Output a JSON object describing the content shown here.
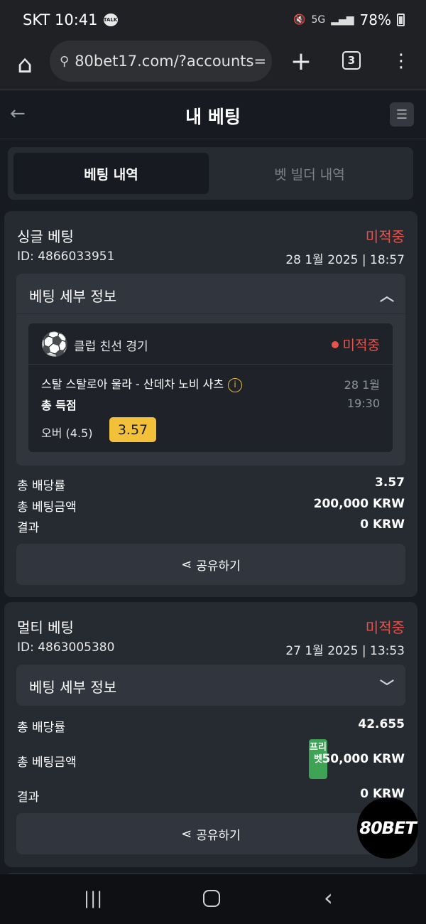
{
  "status_bar": {
    "carrier_time": "SKT 10:41",
    "talk_badge": "TALK",
    "network": "5G",
    "battery": "78%"
  },
  "browser": {
    "url": "80bet17.com/?accounts=",
    "tab_count": "3"
  },
  "header": {
    "title": "내 베팅"
  },
  "tabs": [
    {
      "label": "베팅 내역",
      "active": true
    },
    {
      "label": "벳 빌더 내역",
      "active": false
    }
  ],
  "bets": [
    {
      "type": "싱글 베팅",
      "status": "미적중",
      "id": "ID: 4866033951",
      "datetime": "28 1월 2025 | 18:57",
      "details_title": "베팅 세부 정보",
      "expanded": true,
      "selection": {
        "league": "클럽 친선 경기",
        "status": "미적중",
        "match": "스탈 스탈로아 울라 - 산데차 노비 사츠",
        "date": "28 1월",
        "time": "19:30",
        "market": "총 득점",
        "pick": "오버 (4.5)",
        "odds": "3.57"
      },
      "total_odds_label": "총 배당률",
      "total_odds": "3.57",
      "stake_label": "총 베팅금액",
      "stake": "200,000 KRW",
      "result_label": "결과",
      "result": "0 KRW",
      "share_label": "공유하기"
    },
    {
      "type": "멀티 베팅",
      "status": "미적중",
      "id": "ID: 4863005380",
      "datetime": "27 1월 2025 | 13:53",
      "details_title": "베팅 세부 정보",
      "expanded": false,
      "total_odds_label": "총 배당률",
      "total_odds": "42.655",
      "stake_label": "총 베팅금액",
      "freebet_badge": "프리벳",
      "stake": "50,000 KRW",
      "result_label": "결과",
      "result": "0 KRW",
      "share_label": "공유하기"
    }
  ],
  "watermark": "80BET",
  "colors": {
    "loss": "#e5534b",
    "odds_badge": "#f3c139",
    "freebet": "#3fa356",
    "background": "#171a20",
    "card": "#262a31"
  }
}
